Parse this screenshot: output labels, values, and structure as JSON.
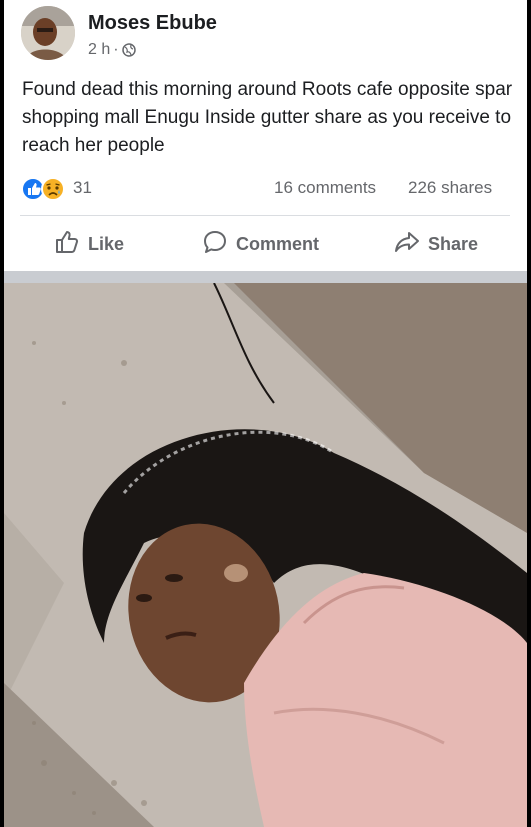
{
  "post": {
    "author": "Moses Ebube",
    "time": "2 h",
    "separator": "·",
    "privacy_icon": "globe-icon",
    "text": "Found dead this morning around Roots cafe opposite spar shopping mall Enugu Inside gutter share as you receive to reach her people",
    "reactions": {
      "icons": [
        "like-reaction-icon",
        "sad-reaction-icon"
      ],
      "count": "31"
    },
    "comments": "16 comments",
    "shares": "226 shares"
  },
  "actions": {
    "like": "Like",
    "comment": "Comment",
    "share": "Share"
  },
  "colors": {
    "like_blue": "#1877f2",
    "sad_yellow": "#f7b125",
    "text": "#1c1e21",
    "secondary_text": "#65676b",
    "background": "#ffffff",
    "frame": "#000000"
  }
}
